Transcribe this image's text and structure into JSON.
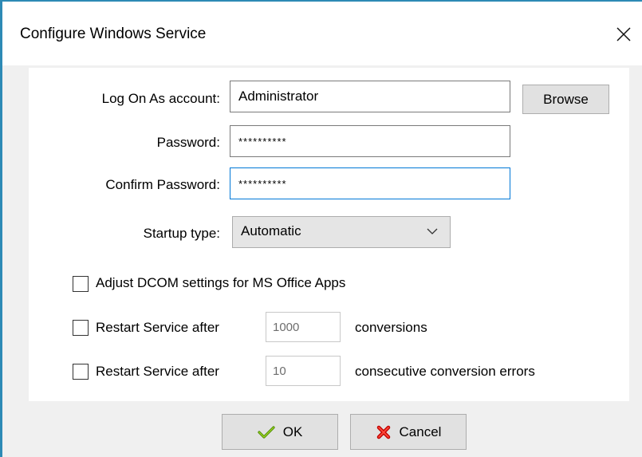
{
  "window": {
    "title": "Configure Windows Service",
    "accent": "#2d8ab5"
  },
  "form": {
    "logon_label": "Log On As account:",
    "logon_value": "Administrator",
    "browse_label": "Browse",
    "password_label": "Password:",
    "password_value": "**********",
    "confirm_label": "Confirm Password:",
    "confirm_value": "**********",
    "startup_label": "Startup type:",
    "startup_value": "Automatic"
  },
  "options": {
    "dcom_label": "Adjust DCOM settings for MS Office Apps",
    "dcom_checked": false,
    "restart1_label": "Restart Service after",
    "restart1_value": "1000",
    "restart1_suffix": "conversions",
    "restart1_checked": false,
    "restart2_label": "Restart Service after",
    "restart2_value": "10",
    "restart2_suffix": "consecutive conversion errors",
    "restart2_checked": false
  },
  "buttons": {
    "ok_label": "OK",
    "cancel_label": "Cancel"
  },
  "icons": {
    "close": "close-icon",
    "chevron": "chevron-down-icon",
    "ok": "checkmark-icon",
    "cancel": "red-x-icon"
  }
}
